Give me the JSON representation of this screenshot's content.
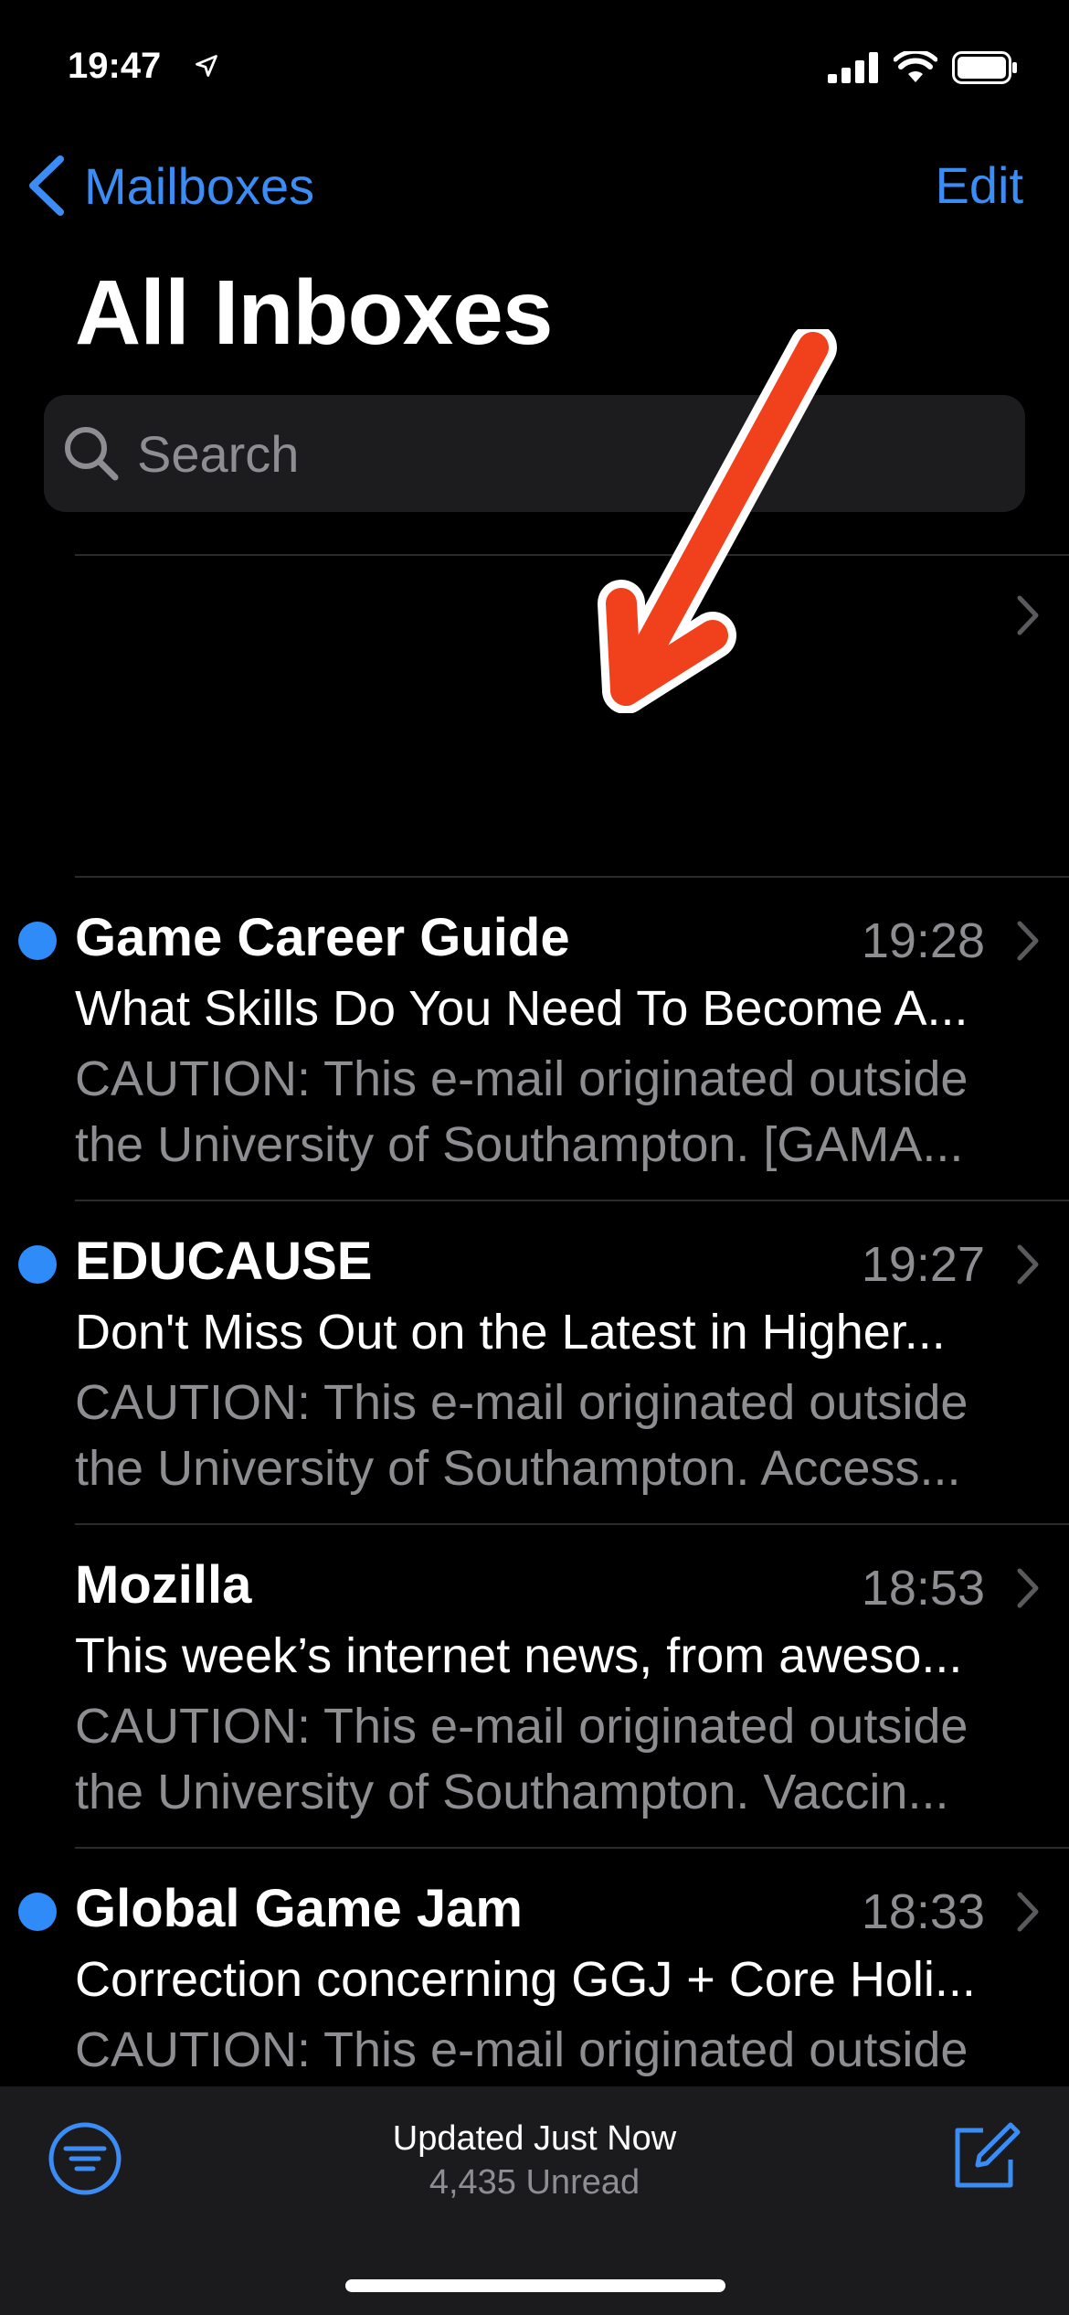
{
  "status_bar": {
    "time": "19:47"
  },
  "nav": {
    "back_label": "Mailboxes",
    "edit_label": "Edit"
  },
  "title": "All Inboxes",
  "search": {
    "placeholder": "Search"
  },
  "messages": [
    {
      "sender": "Game Career Guide",
      "time": "19:28",
      "subject": "What Skills Do You Need To Become A...",
      "preview_line1": "CAUTION: This e-mail originated outside",
      "preview_line2": "the University of Southampton. [GAMA...",
      "unread": true
    },
    {
      "sender": "EDUCAUSE",
      "time": "19:27",
      "subject": "Don't Miss Out on the Latest in Higher...",
      "preview_line1": "CAUTION: This e-mail originated outside",
      "preview_line2": "the University of Southampton. Access...",
      "unread": true
    },
    {
      "sender": "Mozilla",
      "time": "18:53",
      "subject": "This week’s internet news, from aweso...",
      "preview_line1": "CAUTION: This e-mail originated outside",
      "preview_line2": "the University of Southampton. Vaccin...",
      "unread": false
    },
    {
      "sender": "Global Game Jam",
      "time": "18:33",
      "subject": "Correction concerning GGJ + Core Holi...",
      "preview_line1": "CAUTION: This e-mail originated outside",
      "preview_line2": "",
      "unread": true
    }
  ],
  "toolbar": {
    "status": "Updated Just Now",
    "unread_count": "4,435 Unread"
  },
  "colors": {
    "accent": "#3b8df5",
    "unread_dot": "#2f8bf8",
    "arrow": "#f0401c"
  },
  "icons": [
    "location-arrow-icon",
    "cellular-signal-icon",
    "wifi-icon",
    "battery-icon",
    "chevron-left-icon",
    "search-icon",
    "chevron-right-icon",
    "filter-icon",
    "compose-icon"
  ]
}
